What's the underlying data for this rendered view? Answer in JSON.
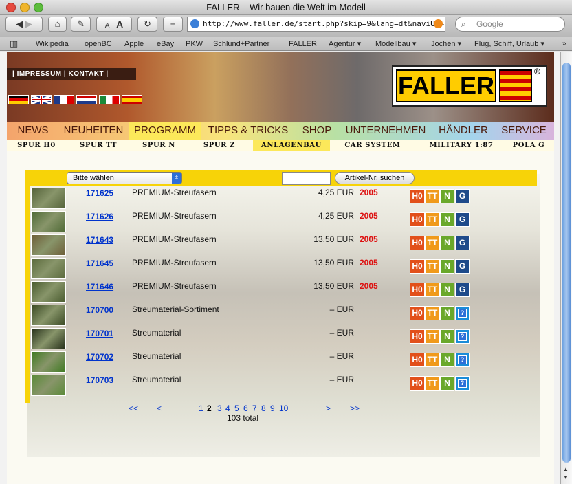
{
  "window": {
    "title": "FALLER – Wir bauen die Welt im Modell"
  },
  "toolbar": {
    "url": "http://www.faller.de/start.php?skip=9&lang=dt&naviUp=",
    "search_placeholder": "Google",
    "text_small": "A",
    "text_large": "A"
  },
  "bookmarks": [
    "Wikipedia",
    "openBC",
    "Apple",
    "eBay",
    "PKW",
    "Schlund+Partner",
    "FALLER",
    "Agentur",
    "Modellbau",
    "Jochen",
    "Flug, Schiff, Urlaub"
  ],
  "header": {
    "links": "| IMPRESSUM | KONTAKT |",
    "logo_text": "FALLER",
    "logo_mark": "®"
  },
  "nav": [
    "NEWS",
    "NEUHEITEN",
    "PROGRAMM",
    "TIPPS & TRICKS",
    "SHOP",
    "UNTERNEHMEN",
    "HÄNDLER",
    "SERVICE"
  ],
  "subnav": [
    "SPUR H0",
    "SPUR TT",
    "SPUR N",
    "SPUR Z",
    "ANLAGENBAU",
    "CAR SYSTEM",
    "MILITARY 1:87",
    "POLA G"
  ],
  "search": {
    "select_label": "Bitte wählen",
    "button_label": "Artikel-Nr. suchen"
  },
  "products": [
    {
      "number": "171625",
      "name": "PREMIUM-Streufasern",
      "price": "4,25 EUR",
      "year": "2005",
      "scales": [
        "H0",
        "TT",
        "N",
        "G"
      ],
      "color": "#55633a"
    },
    {
      "number": "171626",
      "name": "PREMIUM-Streufasern",
      "price": "4,25 EUR",
      "year": "2005",
      "scales": [
        "H0",
        "TT",
        "N",
        "G"
      ],
      "color": "#4f6a36"
    },
    {
      "number": "171643",
      "name": "PREMIUM-Streufasern",
      "price": "13,50 EUR",
      "year": "2005",
      "scales": [
        "H0",
        "TT",
        "N",
        "G"
      ],
      "color": "#6e5e38"
    },
    {
      "number": "171645",
      "name": "PREMIUM-Streufasern",
      "price": "13,50 EUR",
      "year": "2005",
      "scales": [
        "H0",
        "TT",
        "N",
        "G"
      ],
      "color": "#5b6a3c"
    },
    {
      "number": "171646",
      "name": "PREMIUM-Streufasern",
      "price": "13,50 EUR",
      "year": "2005",
      "scales": [
        "H0",
        "TT",
        "N",
        "G"
      ],
      "color": "#4a5c30"
    },
    {
      "number": "170700",
      "name": "Streumaterial-Sortiment",
      "price": "– EUR",
      "year": "",
      "scales": [
        "H0",
        "TT",
        "N",
        "Z"
      ],
      "color": "#3b4a24"
    },
    {
      "number": "170701",
      "name": "Streumaterial",
      "price": "– EUR",
      "year": "",
      "scales": [
        "H0",
        "TT",
        "N",
        "Z"
      ],
      "color": "#26301a"
    },
    {
      "number": "170702",
      "name": "Streumaterial",
      "price": "– EUR",
      "year": "",
      "scales": [
        "H0",
        "TT",
        "N",
        "Z"
      ],
      "color": "#3f7a22"
    },
    {
      "number": "170703",
      "name": "Streumaterial",
      "price": "– EUR",
      "year": "",
      "scales": [
        "H0",
        "TT",
        "N",
        "Z"
      ],
      "color": "#5a8a38"
    }
  ],
  "info_icon": "?",
  "scale_colors": {
    "H0": "#e2501a",
    "TT": "#f09a1a",
    "N": "#6aa82a",
    "G": "#1e4a8a",
    "Z": "#1a8cd8"
  },
  "pagination": {
    "first": "<<",
    "prev": "<",
    "next": ">",
    "last": ">>",
    "pages": [
      "1",
      "2",
      "3",
      "4",
      "5",
      "6",
      "7",
      "8",
      "9",
      "10"
    ],
    "current": "2",
    "total": "103 total"
  }
}
